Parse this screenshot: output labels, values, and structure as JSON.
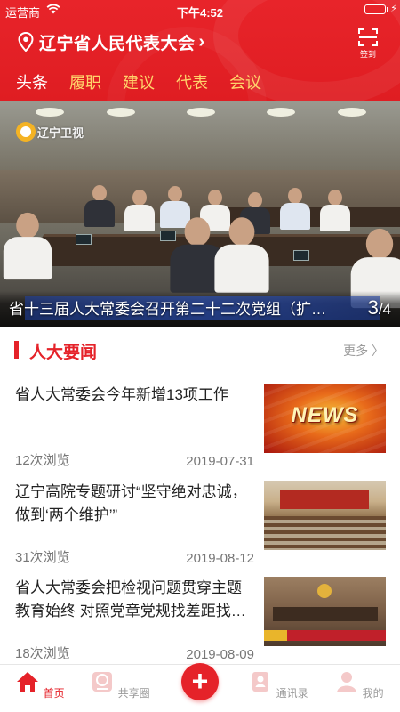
{
  "status_bar": {
    "carrier": "运营商",
    "time": "下午4:52"
  },
  "header": {
    "title": "辽宁省人民代表大会",
    "scan_label": "签到"
  },
  "tabs": [
    {
      "label": "头条",
      "active": true
    },
    {
      "label": "履职",
      "active": false
    },
    {
      "label": "建议",
      "active": false
    },
    {
      "label": "代表",
      "active": false
    },
    {
      "label": "会议",
      "active": false
    }
  ],
  "banner": {
    "logo_text": "辽宁卫视",
    "caption": "省十三届人大常委会召开第二十二次党组（扩大）会议",
    "current_page": "3",
    "total_pages": "/4"
  },
  "news_section": {
    "title": "人大要闻",
    "more_label": "更多 〉",
    "items": [
      {
        "headline": "省人大常委会今年新增13项工作",
        "views": "12次浏览",
        "date": "2019-07-31",
        "thumb_text": "NEWS"
      },
      {
        "headline": "辽宁高院专题研讨“坚守绝对忠诚，做到‘两个维护’”",
        "views": "31次浏览",
        "date": "2019-08-12"
      },
      {
        "headline": "省人大常委会把检视问题贯穿主题教育始终 对照党章党规找差距找问题",
        "views": "18次浏览",
        "date": "2019-08-09"
      }
    ]
  },
  "tabbar": {
    "items": [
      {
        "label": "首页",
        "active": true
      },
      {
        "label": "共享圈",
        "active": false
      },
      {
        "label": "通讯录",
        "active": false
      },
      {
        "label": "我的",
        "active": false
      }
    ],
    "center_symbol": "+"
  },
  "colors": {
    "brand_red": "#e52229",
    "tab_inactive": "#ffd36b"
  }
}
